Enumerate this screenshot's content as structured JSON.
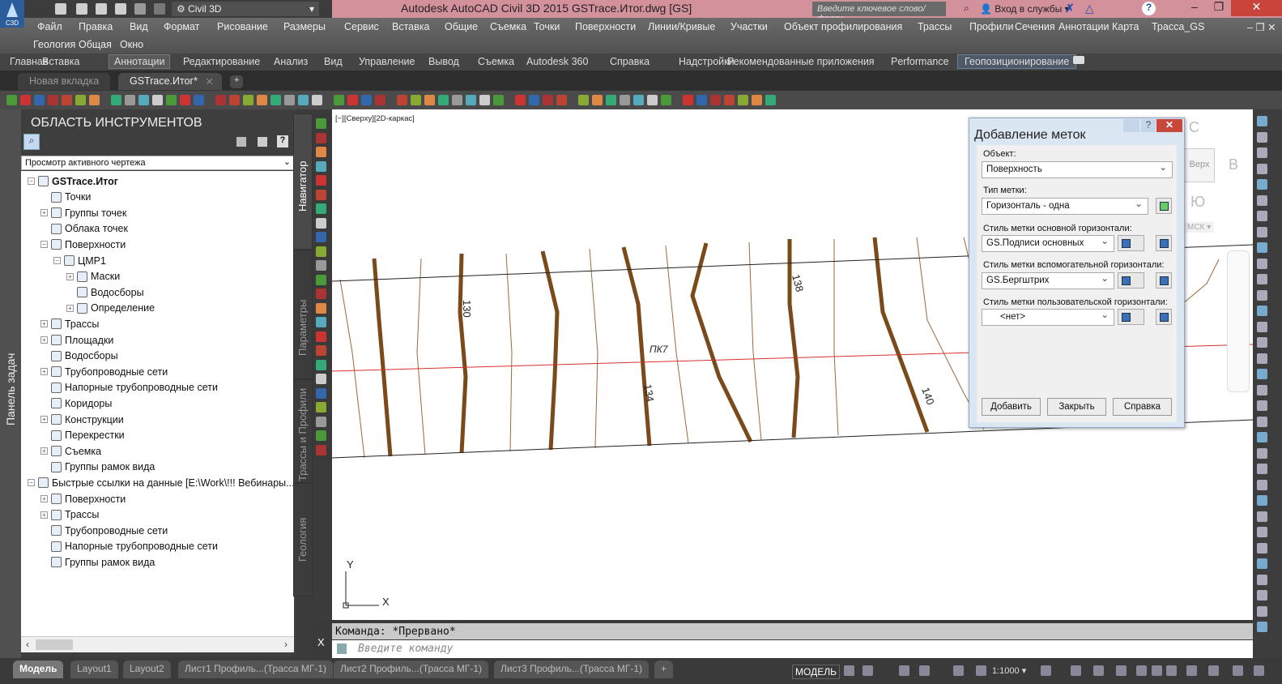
{
  "app": {
    "title": "Autodesk AutoCAD Civil 3D 2015   GSTrace.Итог.dwg [GS]",
    "logo_text": "C3D",
    "workspace": "Civil 3D",
    "search_placeholder": "Введите ключевое слово/фразу",
    "sign_in": "Вход в службы",
    "window_buttons": [
      "–",
      "❐",
      "✕"
    ]
  },
  "menu": {
    "row1": [
      "Файл",
      "Правка",
      "Вид",
      "Формат",
      "Рисование",
      "Размеры",
      "Сервис",
      "Вставка",
      "Общие",
      "Съемка",
      "Точки",
      "Поверхности",
      "Линии/Кривые",
      "Участки",
      "Объект профилирования",
      "Трассы",
      "Профили",
      "Сечения",
      "Аннотации",
      "Карта",
      "Трасса_GS"
    ],
    "row2": [
      "Геология",
      "Общая",
      "Окно"
    ]
  },
  "ribbon": {
    "tabs": [
      "Главная",
      "Вставка",
      "Аннотации",
      "Редактирование",
      "Анализ",
      "Вид",
      "Управление",
      "Вывод",
      "Съемка",
      "Autodesk 360",
      "Справка",
      "Надстройки",
      "Рекомендованные приложения",
      "Performance",
      "Геопозиционирование"
    ],
    "active": "Аннотации"
  },
  "doc_tabs": [
    {
      "label": "Новая вкладка"
    },
    {
      "label": "GSTrace.Итог*",
      "close": "✕"
    },
    {
      "label": "+"
    }
  ],
  "taskpanel_label": "Панель задач",
  "toolspace": {
    "title": "ОБЛАСТЬ ИНСТРУМЕНТОВ",
    "view_select": "Просмотр активного чертежа",
    "help": "?",
    "tree": [
      {
        "label": "GSTrace.Итог",
        "level": 0,
        "exp": "−",
        "bold": true
      },
      {
        "label": "Точки",
        "level": 1
      },
      {
        "label": "Группы точек",
        "level": 1,
        "exp": "+"
      },
      {
        "label": "Облака точек",
        "level": 1
      },
      {
        "label": "Поверхности",
        "level": 1,
        "exp": "−"
      },
      {
        "label": "ЦМР1",
        "level": 2,
        "exp": "−"
      },
      {
        "label": "Маски",
        "level": 3,
        "exp": "+"
      },
      {
        "label": "Водосборы",
        "level": 3
      },
      {
        "label": "Определение",
        "level": 3,
        "exp": "+"
      },
      {
        "label": "Трассы",
        "level": 1,
        "exp": "+"
      },
      {
        "label": "Площадки",
        "level": 1,
        "exp": "+"
      },
      {
        "label": "Водосборы",
        "level": 1
      },
      {
        "label": "Трубопроводные сети",
        "level": 1,
        "exp": "+"
      },
      {
        "label": "Напорные трубопроводные сети",
        "level": 1
      },
      {
        "label": "Коридоры",
        "level": 1
      },
      {
        "label": "Конструкции",
        "level": 1,
        "exp": "+"
      },
      {
        "label": "Перекрестки",
        "level": 1
      },
      {
        "label": "Съемка",
        "level": 1,
        "exp": "+"
      },
      {
        "label": "Группы рамок вида",
        "level": 1
      },
      {
        "label": "Быстрые ссылки на данные [E:\\Work\\!!! Вебинары...",
        "level": 0,
        "exp": "−"
      },
      {
        "label": "Поверхности",
        "level": 1,
        "exp": "+"
      },
      {
        "label": "Трассы",
        "level": 1,
        "exp": "+"
      },
      {
        "label": "Трубопроводные сети",
        "level": 1
      },
      {
        "label": "Напорные трубопроводные сети",
        "level": 1
      },
      {
        "label": "Группы рамок вида",
        "level": 1
      }
    ],
    "vertical_tabs": [
      "Навигатор",
      "Параметры",
      "Трассы и Профили",
      "Геология"
    ]
  },
  "viewport": {
    "label": "[−][Сверху][2D-каркас]",
    "contour_labels": [
      "130",
      "134",
      "138",
      "140"
    ],
    "station_label": "ПК7",
    "axis_x": "X",
    "axis_y": "Y",
    "viewcube": {
      "north": "С",
      "east": "В",
      "south": "Ю",
      "top": "Верх",
      "ucs": "МСК ▾"
    },
    "colors": {
      "major_contour": "#7a4a1a",
      "minor_contour": "#9b6a3c",
      "alignment": "#d83030"
    }
  },
  "dialog": {
    "title": "Добавление меток",
    "object_label": "Объект:",
    "object_value": "Поверхность",
    "type_label": "Тип метки:",
    "type_value": "Горизонталь - одна",
    "major_label": "Стиль метки основной горизонтали:",
    "major_value": "GS.Подписи основных",
    "minor_label": "Стиль метки вспомогательной горизонтали:",
    "minor_value": "GS.Бергштрих",
    "user_label": "Стиль метки пользовательской горизонтали:",
    "user_value": "<нет>",
    "buttons": {
      "add": "Добавить",
      "close": "Закрыть",
      "help": "Справка"
    }
  },
  "command": {
    "history": "Команда:  *Прервано*",
    "placeholder": "Введите команду",
    "close": "X"
  },
  "status": {
    "layout_tabs": [
      "Модель",
      "Layout1",
      "Layout2",
      "Лист1 Профиль...(Трасса МГ-1)",
      "Лист2 Профиль...(Трасса МГ-1)",
      "Лист3 Профиль...(Трасса МГ-1)",
      "+"
    ],
    "active_tab": "Модель",
    "mode": "МОДЕЛЬ",
    "scale": "1:1000 ▾"
  }
}
